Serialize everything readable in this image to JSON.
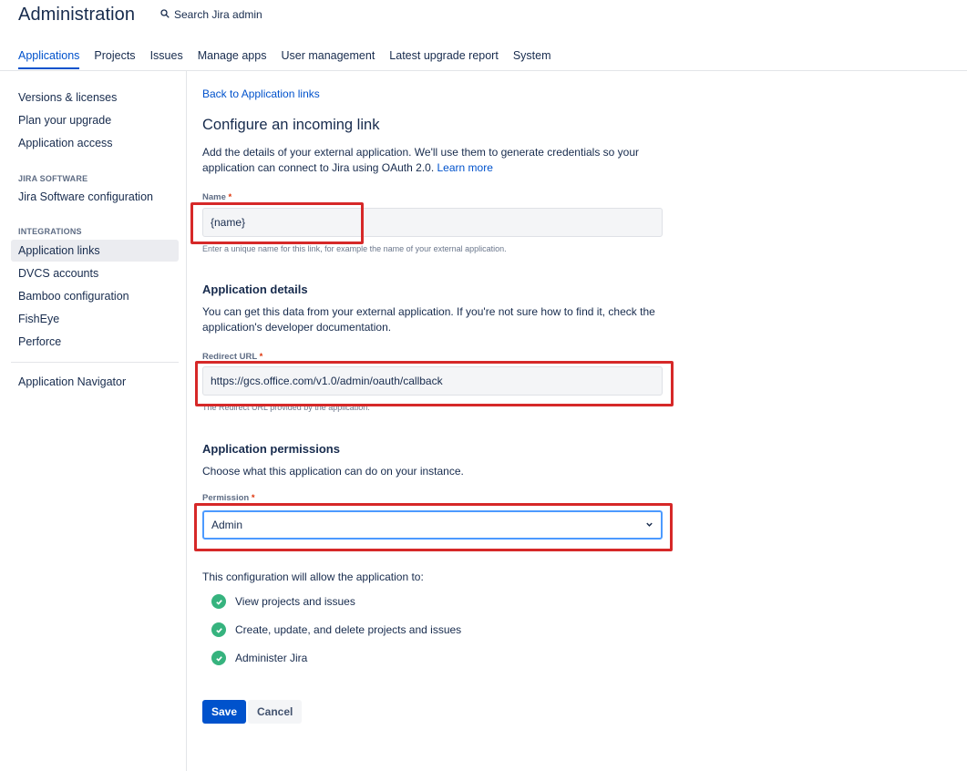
{
  "header": {
    "title": "Administration",
    "search_label": "Search Jira admin",
    "tabs": [
      {
        "label": "Applications",
        "active": true
      },
      {
        "label": "Projects",
        "active": false
      },
      {
        "label": "Issues",
        "active": false
      },
      {
        "label": "Manage apps",
        "active": false
      },
      {
        "label": "User management",
        "active": false
      },
      {
        "label": "Latest upgrade report",
        "active": false
      },
      {
        "label": "System",
        "active": false
      }
    ]
  },
  "sidebar": {
    "items_top": [
      "Versions & licenses",
      "Plan your upgrade",
      "Application access"
    ],
    "jira_software_heading": "JIRA SOFTWARE",
    "jira_software_items": [
      "Jira Software configuration"
    ],
    "integrations_heading": "INTEGRATIONS",
    "integrations_items": [
      "Application links",
      "DVCS accounts",
      "Bamboo configuration",
      "FishEye",
      "Perforce"
    ],
    "bottom_items": [
      "Application Navigator"
    ],
    "active_item": "Application links"
  },
  "main": {
    "back_link": "Back to Application links",
    "title": "Configure an incoming link",
    "intro_text": "Add the details of your external application. We'll use them to generate credentials so your application can connect to Jira using OAuth 2.0.",
    "learn_more": "Learn more",
    "name_field": {
      "label": "Name",
      "required_mark": "*",
      "value": "{name}",
      "helper": "Enter a unique name for this link, for example the name of your external application."
    },
    "app_details": {
      "title": "Application details",
      "text": "You can get this data from your external application. If you're not sure how to find it, check the application's developer documentation."
    },
    "redirect_field": {
      "label": "Redirect URL",
      "required_mark": "*",
      "value": "https://gcs.office.com/v1.0/admin/oauth/callback",
      "helper": "The Redirect URL provided by the application."
    },
    "permissions": {
      "title": "Application permissions",
      "text": "Choose what this application can do on your instance.",
      "label": "Permission",
      "required_mark": "*",
      "selected": "Admin"
    },
    "allow_text": "This configuration will allow the application to:",
    "allowed": [
      "View projects and issues",
      "Create, update, and delete projects and issues",
      "Administer Jira"
    ],
    "save_label": "Save",
    "cancel_label": "Cancel"
  },
  "colors": {
    "link": "#0052cc",
    "primary_button": "#0052cc",
    "check_green": "#36b37e",
    "highlight_red": "#d62828",
    "select_focus": "#4c9aff"
  },
  "icons": {
    "search": "search-icon",
    "dropdown": "chevron-down-icon",
    "check": "check-circle-icon"
  }
}
